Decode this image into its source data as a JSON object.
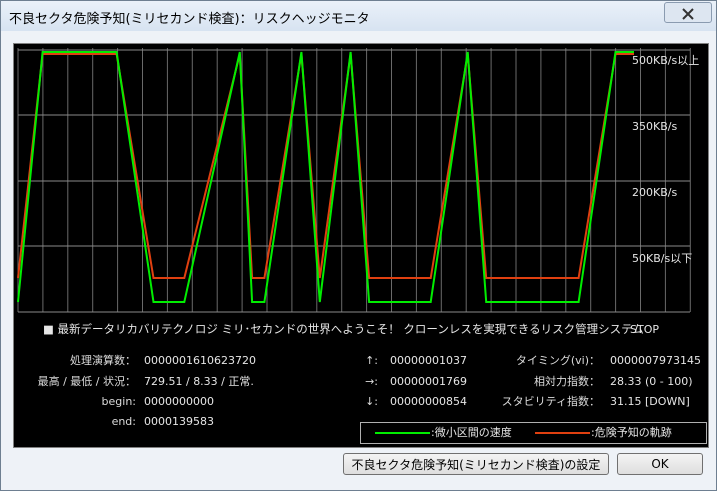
{
  "window": {
    "title": "不良セクタ危険予知(ミリセカンド検査)：リスクヘッジモニタ",
    "close_glyph": "X"
  },
  "chart_data": {
    "type": "line",
    "y_levels": [
      "500KB/s以上",
      "350KB/s",
      "200KB/s",
      "50KB/s以下"
    ],
    "status": "STOP",
    "series": [
      {
        "name": ":微小区間の速度",
        "color": "#00ee00",
        "values": [
          [
            0,
            "50KB/s以下"
          ],
          [
            4,
            "500KB/s以上"
          ],
          [
            16,
            "500KB/s以上"
          ],
          [
            22,
            "50KB/s以下"
          ],
          [
            27,
            "50KB/s以下"
          ],
          [
            36,
            "500KB/s以上"
          ],
          [
            38,
            "50KB/s以下"
          ],
          [
            40,
            "50KB/s以下"
          ],
          [
            46,
            "500KB/s以上"
          ],
          [
            49,
            "50KB/s以下"
          ],
          [
            54,
            "500KB/s以上"
          ],
          [
            57,
            "50KB/s以下"
          ],
          [
            67,
            "50KB/s以下"
          ],
          [
            73,
            "500KB/s以上"
          ],
          [
            76,
            "50KB/s以下"
          ],
          [
            91,
            "50KB/s以下"
          ],
          [
            97,
            "500KB/s以上"
          ],
          [
            100,
            "500KB/s以上"
          ]
        ]
      },
      {
        "name": ":危険予知の軌跡",
        "color": "#e04010",
        "values": [
          [
            0,
            "50KB/s以下"
          ],
          [
            4,
            "500KB/s以上"
          ],
          [
            16,
            "500KB/s以上"
          ],
          [
            22,
            "50KB/s以下"
          ],
          [
            27,
            "50KB/s以下"
          ],
          [
            36,
            "500KB/s以上"
          ],
          [
            38,
            "50KB/s以下"
          ],
          [
            40,
            "50KB/s以下"
          ],
          [
            46,
            "500KB/s以上"
          ],
          [
            49,
            "50KB/s以下"
          ],
          [
            54,
            "500KB/s以上"
          ],
          [
            57,
            "50KB/s以下"
          ],
          [
            67,
            "50KB/s以下"
          ],
          [
            73,
            "500KB/s以上"
          ],
          [
            76,
            "50KB/s以下"
          ],
          [
            91,
            "50KB/s以下"
          ],
          [
            97,
            "500KB/s以上"
          ],
          [
            100,
            "500KB/s以上"
          ]
        ]
      }
    ],
    "grid": true
  },
  "headline": "■ 最新データリカバリテクノロジ ミリ･セカンドの世界へようこそ！ クローンレスを実現できるリスク管理システム",
  "stats": {
    "processed_label": "処理演算数：",
    "processed_value": "0000001610623720",
    "maxmin_label": "最高 / 最低 / 状況：",
    "maxmin_value": "729.51 / 8.33 / 正常.",
    "begin_label": "begin:",
    "begin_value": "0000000000",
    "end_label": "end:",
    "end_value": "0000139583",
    "up_label": "↑:",
    "up_value": "00000001037",
    "right_label": "→:",
    "right_value": "00000001769",
    "down_label": "↓:",
    "down_value": "00000000854",
    "timing_label": "タイミング(vi)：",
    "timing_value": "0000007973145",
    "relative_label": "相対力指数：",
    "relative_value": "28.33 (0 - 100)",
    "stability_label": "スタビリティ指数：",
    "stability_value": "31.15 [DOWN]"
  },
  "buttons": {
    "settings_label": "不良セクタ危険予知(ミリセカンド検査)の設定",
    "ok_label": "OK"
  }
}
